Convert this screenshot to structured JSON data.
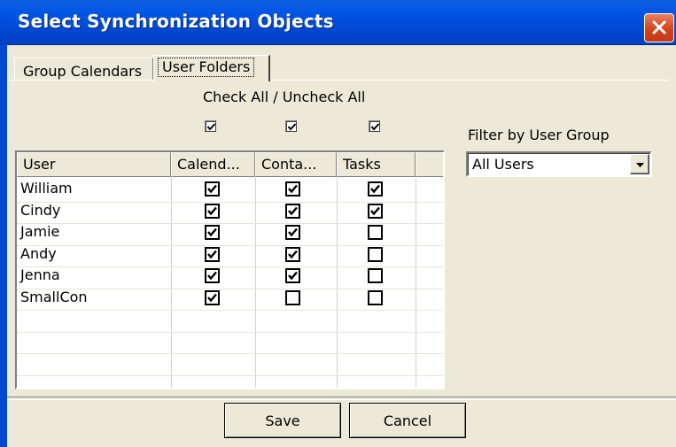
{
  "window": {
    "title": "Select Synchronization Objects"
  },
  "tabs": [
    {
      "label": "Group Calendars",
      "active": false
    },
    {
      "label": "User Folders",
      "active": true
    }
  ],
  "check_all_label": "Check All / Uncheck All",
  "check_all": [
    true,
    true,
    true
  ],
  "filter": {
    "label": "Filter by User Group",
    "value": "All Users"
  },
  "grid": {
    "columns": [
      "User",
      "Calend...",
      "Conta...",
      "Tasks"
    ],
    "rows": [
      {
        "user": "William",
        "calendar": true,
        "contacts": true,
        "tasks": true
      },
      {
        "user": "Cindy",
        "calendar": true,
        "contacts": true,
        "tasks": true
      },
      {
        "user": "Jamie",
        "calendar": true,
        "contacts": true,
        "tasks": false
      },
      {
        "user": "Andy",
        "calendar": true,
        "contacts": true,
        "tasks": false
      },
      {
        "user": "Jenna",
        "calendar": true,
        "contacts": true,
        "tasks": false
      },
      {
        "user": "SmallCon",
        "calendar": true,
        "contacts": false,
        "tasks": false
      }
    ]
  },
  "buttons": {
    "save": "Save",
    "cancel": "Cancel"
  }
}
